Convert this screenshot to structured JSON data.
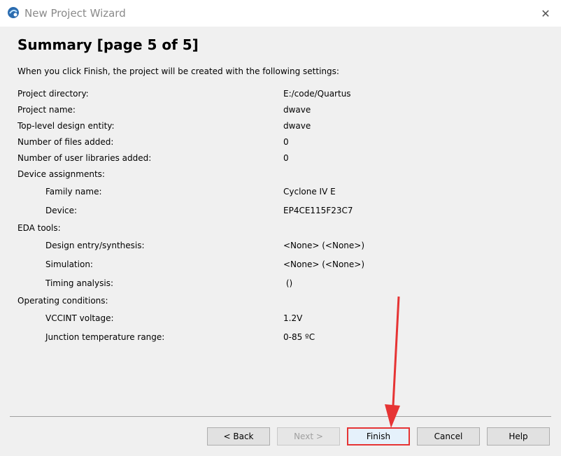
{
  "window": {
    "title": "New Project Wizard",
    "icon": "quartus-app-icon",
    "close_glyph": "✕"
  },
  "page": {
    "title": "Summary [page 5 of 5]",
    "intro": "When you click Finish, the project will be created with the following settings:"
  },
  "settings": {
    "project_directory": {
      "label": "Project directory:",
      "value": "E:/code/Quartus"
    },
    "project_name": {
      "label": "Project name:",
      "value": "dwave"
    },
    "top_level_entity": {
      "label": "Top-level design entity:",
      "value": "dwave"
    },
    "files_added": {
      "label": "Number of files added:",
      "value": "0"
    },
    "user_libraries_added": {
      "label": "Number of user libraries added:",
      "value": "0"
    },
    "device_assignments": {
      "label": "Device assignments:"
    },
    "family_name": {
      "label": "Family name:",
      "value": "Cyclone IV E"
    },
    "device": {
      "label": "Device:",
      "value": "EP4CE115F23C7"
    },
    "eda_tools": {
      "label": "EDA tools:"
    },
    "design_entry": {
      "label": "Design entry/synthesis:",
      "value": "<None> (<None>)"
    },
    "simulation": {
      "label": "Simulation:",
      "value": "<None> (<None>)"
    },
    "timing_analysis": {
      "label": "Timing analysis:",
      "value": " ()"
    },
    "operating_conditions": {
      "label": "Operating conditions:"
    },
    "vccint_voltage": {
      "label": "VCCINT voltage:",
      "value": "1.2V"
    },
    "junction_temp": {
      "label": "Junction temperature range:",
      "value": "0-85 ºC"
    }
  },
  "buttons": {
    "back": "< Back",
    "next": "Next >",
    "finish": "Finish",
    "cancel": "Cancel",
    "help": "Help"
  },
  "colors": {
    "annotation_red": "#e63434",
    "panel_bg": "#f0f0f0",
    "title_text": "#8a8a8a"
  }
}
